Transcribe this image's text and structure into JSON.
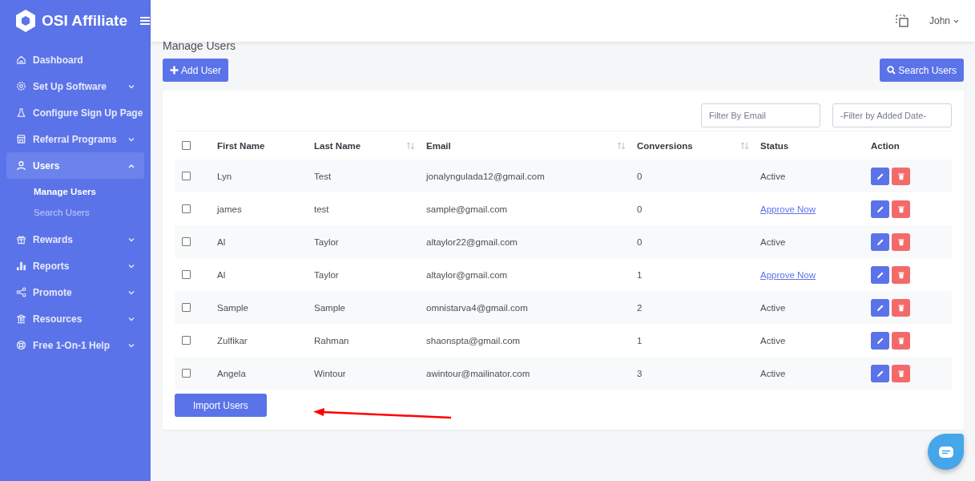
{
  "brand": {
    "name": "OSI Affiliate"
  },
  "sidebar": {
    "items": [
      {
        "label": "Dashboard",
        "kind": "link",
        "selected": false
      },
      {
        "label": "Set Up Software",
        "kind": "group",
        "expanded": false,
        "selected": false
      },
      {
        "label": "Configure Sign Up Page",
        "kind": "link",
        "selected": false
      },
      {
        "label": "Referral Programs",
        "kind": "group",
        "expanded": false,
        "selected": false
      },
      {
        "label": "Users",
        "kind": "group",
        "expanded": true,
        "selected": true,
        "children": [
          {
            "label": "Manage Users",
            "selected": true
          },
          {
            "label": "Search Users",
            "selected": false
          }
        ]
      },
      {
        "label": "Rewards",
        "kind": "group",
        "expanded": false,
        "selected": false
      },
      {
        "label": "Reports",
        "kind": "group",
        "expanded": false,
        "selected": false
      },
      {
        "label": "Promote",
        "kind": "group",
        "expanded": false,
        "selected": false
      },
      {
        "label": "Resources",
        "kind": "group",
        "expanded": false,
        "selected": false
      },
      {
        "label": "Free 1-On-1 Help",
        "kind": "group",
        "expanded": false,
        "selected": false
      }
    ]
  },
  "header": {
    "user": "John"
  },
  "page_title": "Manage Users",
  "add_button": "Add User",
  "search_button": "Search Users",
  "filters": [
    {
      "placeholder": "Filter By Email"
    },
    {
      "placeholder": "-Filter by Added Date-"
    }
  ],
  "table": {
    "all_checked": false,
    "columns": [
      {
        "label": "First Name",
        "sortable": false
      },
      {
        "label": "Last Name",
        "sortable": true
      },
      {
        "label": "Email",
        "sortable": true
      },
      {
        "label": "Conversions",
        "sortable": true
      },
      {
        "label": "Status",
        "sortable": false
      },
      {
        "label": "Action",
        "sortable": false
      }
    ],
    "rows": [
      {
        "checked": false,
        "first": "Lyn",
        "last": "Test",
        "email": "jonalyngulada12@gmail.com",
        "conversions": "0",
        "status": {
          "text": "Active",
          "kind": "text"
        }
      },
      {
        "checked": false,
        "first": "james",
        "last": "test",
        "email": "sample@gmail.com",
        "conversions": "0",
        "status": {
          "text": "Approve Now",
          "kind": "link"
        }
      },
      {
        "checked": false,
        "first": "Al",
        "last": "Taylor",
        "email": "altaylor22@gmail.com",
        "conversions": "0",
        "status": {
          "text": "Active",
          "kind": "text"
        }
      },
      {
        "checked": false,
        "first": "Al",
        "last": "Taylor",
        "email": "altaylor@gmail.com",
        "conversions": "1",
        "status": {
          "text": "Approve Now",
          "kind": "link"
        }
      },
      {
        "checked": false,
        "first": "Sample",
        "last": "Sample",
        "email": "omnistarva4@gmail.com",
        "conversions": "2",
        "status": {
          "text": "Active",
          "kind": "text"
        }
      },
      {
        "checked": false,
        "first": "Zulfikar",
        "last": "Rahman",
        "email": "shaonspta@gmail.com",
        "conversions": "1",
        "status": {
          "text": "Active",
          "kind": "text"
        }
      },
      {
        "checked": false,
        "first": "Angela",
        "last": "Wintour",
        "email": "awintour@mailinator.com",
        "conversions": "3",
        "status": {
          "text": "Active",
          "kind": "text"
        }
      }
    ]
  },
  "import_button": "Import Users"
}
